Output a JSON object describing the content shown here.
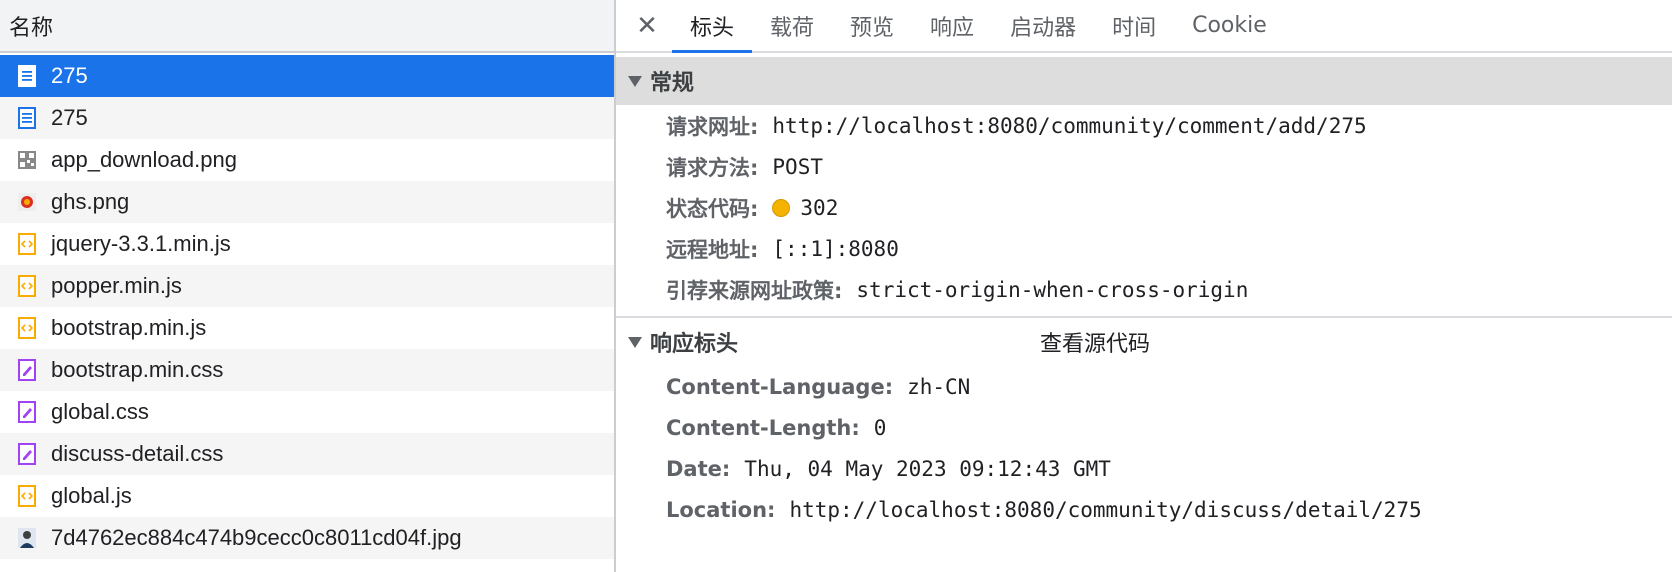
{
  "left": {
    "header": "名称",
    "rows": [
      {
        "name": "275",
        "icon": "document-icon",
        "selected": true
      },
      {
        "name": "275",
        "icon": "document-icon"
      },
      {
        "name": "app_download.png",
        "icon": "image-qr-icon"
      },
      {
        "name": "ghs.png",
        "icon": "image-badge-icon"
      },
      {
        "name": "jquery-3.3.1.min.js",
        "icon": "script-icon"
      },
      {
        "name": "popper.min.js",
        "icon": "script-icon"
      },
      {
        "name": "bootstrap.min.js",
        "icon": "script-icon"
      },
      {
        "name": "bootstrap.min.css",
        "icon": "stylesheet-icon"
      },
      {
        "name": "global.css",
        "icon": "stylesheet-icon"
      },
      {
        "name": "discuss-detail.css",
        "icon": "stylesheet-icon"
      },
      {
        "name": "global.js",
        "icon": "script-icon"
      },
      {
        "name": "7d4762ec884c474b9cecc0c8011cd04f.jpg",
        "icon": "image-photo-icon"
      }
    ]
  },
  "right": {
    "close": "✕",
    "tabs": [
      "标头",
      "载荷",
      "预览",
      "响应",
      "启动器",
      "时间",
      "Cookie"
    ],
    "general": {
      "title": "常规",
      "items": [
        {
          "key": "请求网址:",
          "value": "http://localhost:8080/community/comment/add/275"
        },
        {
          "key": "请求方法:",
          "value": "POST"
        },
        {
          "key": "状态代码:",
          "value": "302",
          "status_color": "#f3b300"
        },
        {
          "key": "远程地址:",
          "value": "[::1]:8080"
        },
        {
          "key": "引荐来源网址政策:",
          "value": "strict-origin-when-cross-origin"
        }
      ]
    },
    "response_headers": {
      "title": "响应标头",
      "view_source": "查看源代码",
      "items": [
        {
          "key": "Content-Language:",
          "value": "zh-CN"
        },
        {
          "key": "Content-Length:",
          "value": "0"
        },
        {
          "key": "Date:",
          "value": "Thu, 04 May 2023 09:12:43 GMT"
        },
        {
          "key": "Location:",
          "value": "http://localhost:8080/community/discuss/detail/275"
        }
      ]
    }
  },
  "colors": {
    "accent": "#1a73e8",
    "script": "#f9ab00",
    "stylesheet": "#a142f4",
    "document": "#1a73e8"
  }
}
